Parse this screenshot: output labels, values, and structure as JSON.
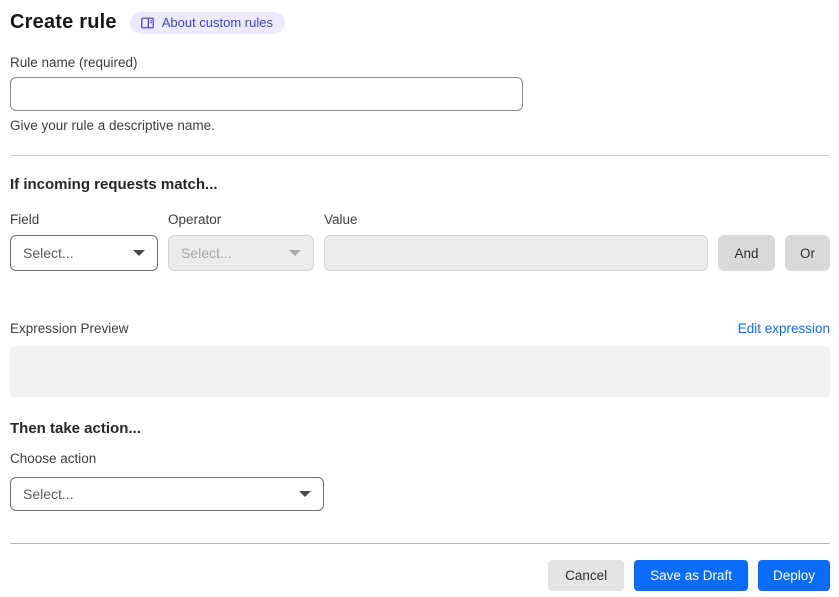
{
  "header": {
    "title": "Create rule",
    "about_link": "About custom rules"
  },
  "rule_name": {
    "label": "Rule name (required)",
    "value": "",
    "helper": "Give your rule a descriptive name."
  },
  "match_section": {
    "heading": "If incoming requests match...",
    "field": {
      "label": "Field",
      "selected": "Select..."
    },
    "operator": {
      "label": "Operator",
      "selected": "Select...",
      "disabled": true
    },
    "value": {
      "label": "Value",
      "value": "",
      "disabled": true
    },
    "and_button": "And",
    "or_button": "Or",
    "expression_preview_label": "Expression Preview",
    "edit_expression_link": "Edit expression",
    "expression_value": ""
  },
  "action_section": {
    "heading": "Then take action...",
    "choose_action_label": "Choose action",
    "action_selected": "Select..."
  },
  "footer": {
    "cancel": "Cancel",
    "save_draft": "Save as Draft",
    "deploy": "Deploy"
  },
  "colors": {
    "primary_blue": "#0b6cfb",
    "link_blue": "#0b6cfb",
    "badge_bg": "#eceafb",
    "badge_text": "#4642c4",
    "disabled_bg": "#ececec",
    "neutral_btn_bg": "#d9d9d9",
    "cancel_bg": "#e4e4e4",
    "preview_bg": "#f2f2f2"
  },
  "icons": {
    "about_badge_icon": "book-docs-icon",
    "dropdown_icon": "chevron-down-icon"
  }
}
